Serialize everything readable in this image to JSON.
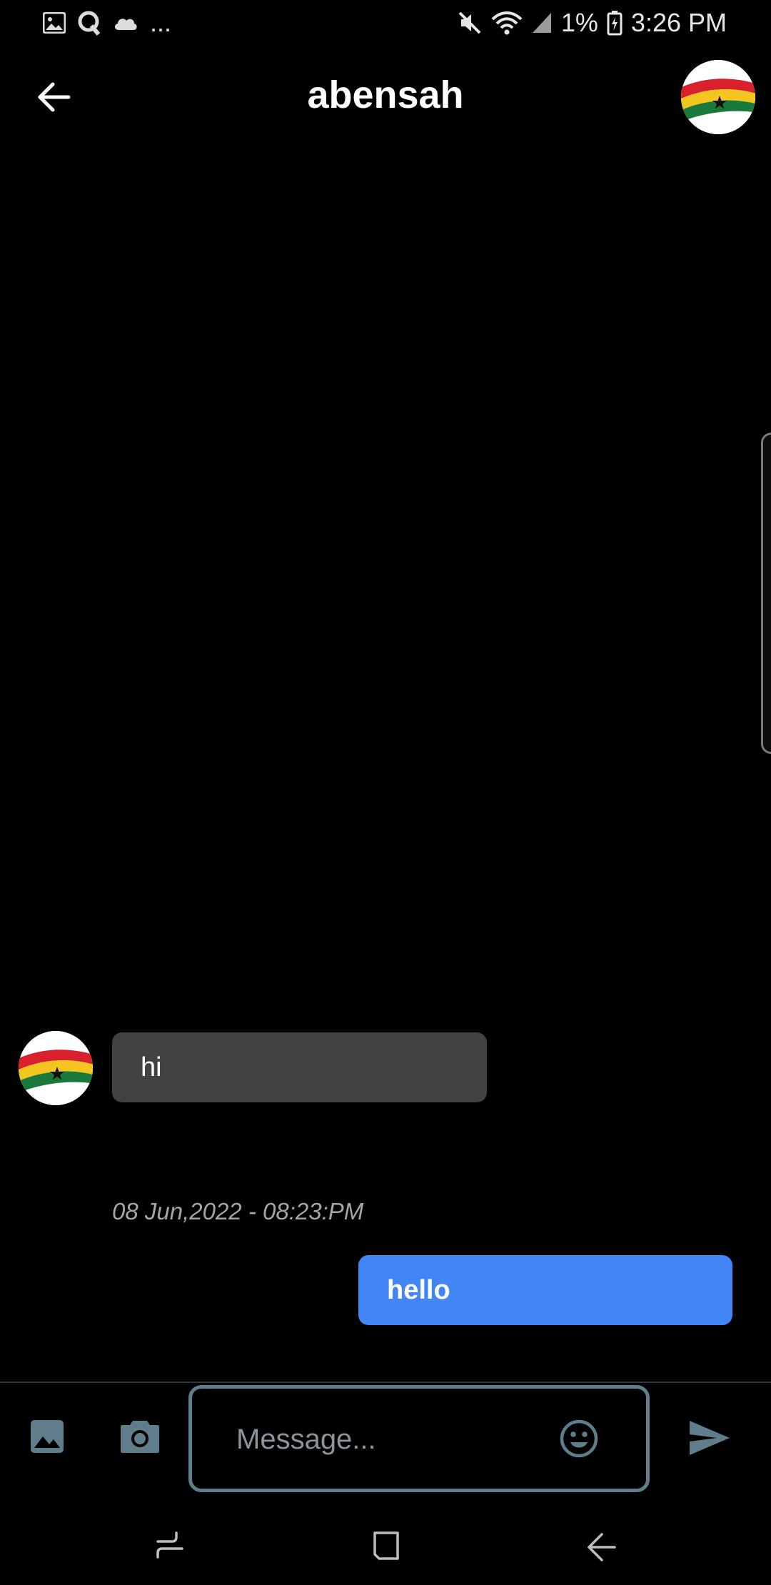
{
  "status_bar": {
    "time": "3:26 PM",
    "battery": "1%",
    "overflow": "...",
    "icons": [
      "gallery-icon",
      "q-app-icon",
      "cloud-icon",
      "mute-icon",
      "wifi-icon",
      "signal-icon",
      "battery-charging-icon"
    ]
  },
  "header": {
    "title": "abensah",
    "back_icon": "arrow-left-icon",
    "avatar": "ghana-flag-avatar"
  },
  "messages": [
    {
      "direction": "incoming",
      "text": "hi",
      "avatar": "ghana-flag-avatar"
    },
    {
      "direction": "outgoing",
      "timestamp": "08 Jun,2022 - 08:23:PM",
      "text": "hello"
    }
  ],
  "composer": {
    "placeholder": "Message...",
    "value": "",
    "icons": [
      "image-icon",
      "camera-icon",
      "emoji-icon",
      "send-icon"
    ]
  },
  "nav_bar": {
    "icons": [
      "recent-apps-icon",
      "home-icon",
      "back-icon"
    ]
  },
  "colors": {
    "background": "#000000",
    "incoming_bubble": "#424242",
    "outgoing_bubble": "#4285f4",
    "composer_accent": "#607d8b",
    "timestamp": "#a5a5a5"
  }
}
